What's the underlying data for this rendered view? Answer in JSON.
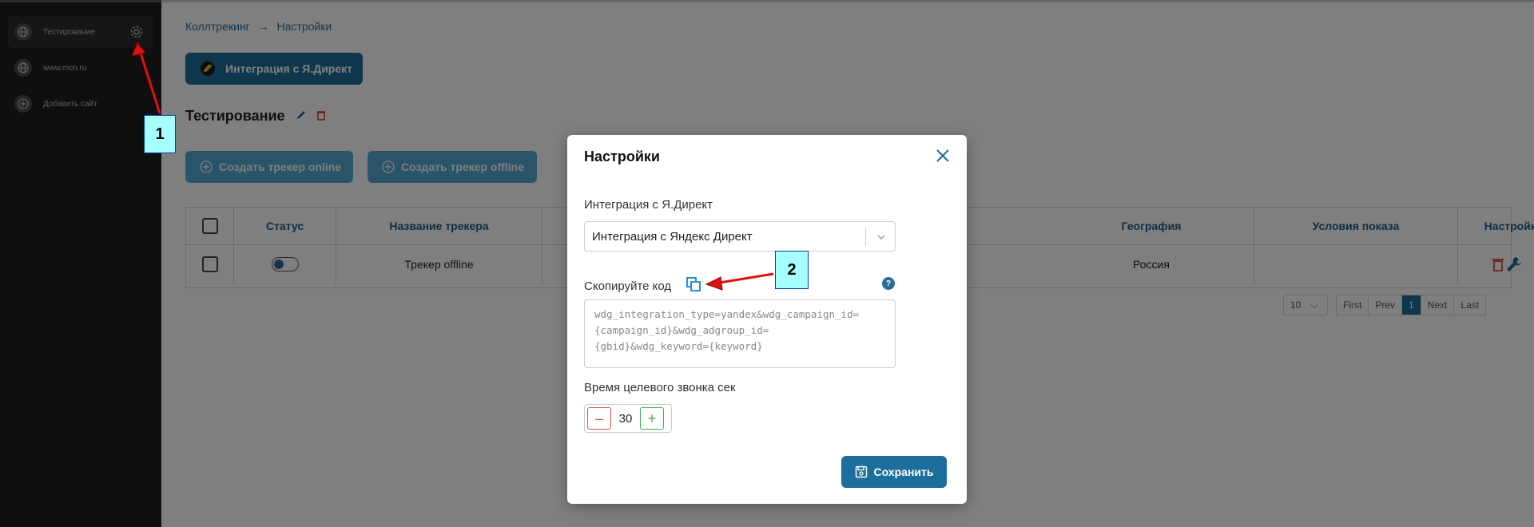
{
  "sidebar": {
    "items": [
      {
        "label": "Тестирование",
        "active": true
      },
      {
        "label": "www.mcn.ru"
      },
      {
        "label": "Добавить сайт"
      }
    ]
  },
  "breadcrumb": {
    "root": "Коллтрекинг",
    "arrow": "→",
    "current": "Настройки"
  },
  "integration_button": "Интеграция с Я.Директ",
  "site_title": "Тестирование",
  "buttons": {
    "create_online": "Создать трекер online",
    "create_offline": "Создать трекер offline"
  },
  "table": {
    "headers": [
      "Статус",
      "Название трекера",
      "География",
      "Условия показа",
      "Настройки"
    ],
    "row": {
      "name": "Трекер offline",
      "geo": "Россия"
    }
  },
  "pager": {
    "per_page": "10",
    "first": "First",
    "prev": "Prev",
    "page": "1",
    "next": "Next",
    "last": "Last"
  },
  "modal": {
    "title": "Настройки",
    "integration_label": "Интеграция с Я.Директ",
    "integration_value": "Интеграция с Яндекс Директ",
    "copy_label": "Скопируйте код",
    "help": "?",
    "code_lines": [
      "wdg_integration_type=yandex&wdg_campaign_id=",
      "{campaign_id}&wdg_adgroup_id=",
      "{gbid}&wdg_keyword={keyword}"
    ],
    "time_label": "Время целевого звонка сек",
    "time_value": "30",
    "minus": "–",
    "plus": "+",
    "save": "Сохранить"
  },
  "annotations": {
    "one": "1",
    "two": "2"
  },
  "colors": {
    "accent": "#1c6f9c",
    "annotation_bg": "#a6ffff",
    "arrow": "#e01010"
  }
}
